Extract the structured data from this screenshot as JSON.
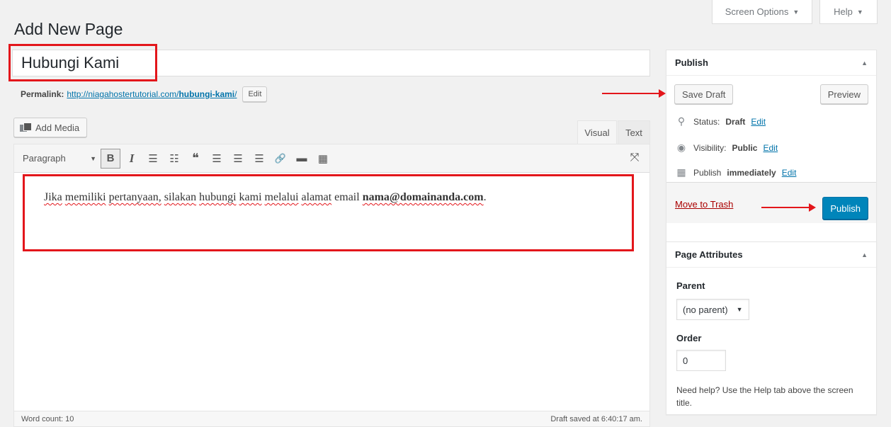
{
  "screen_meta": {
    "screen_options": "Screen Options",
    "help": "Help",
    "caret": "▼"
  },
  "page_title": "Add New Page",
  "post_title": {
    "value": "Hubungi Kami"
  },
  "permalink": {
    "label": "Permalink:",
    "url_base": "http://niagahostertutorial.com/",
    "slug": "hubungi-kami",
    "trailing": "/",
    "edit_label": "Edit"
  },
  "media": {
    "add_media_label": "Add Media"
  },
  "editor_tabs": {
    "visual": "Visual",
    "text": "Text"
  },
  "toolbar": {
    "format": "Paragraph",
    "format_caret": "▼",
    "bold": "B",
    "italic": "I",
    "bullet_list": "☰",
    "numbered_list": "☷",
    "blockquote": "❝",
    "align_left": "☰",
    "align_center": "☰",
    "align_right": "☰",
    "link": "🔗",
    "read_more": "▬",
    "toolbar_toggle": "▦",
    "fullscreen": "⤧"
  },
  "content": {
    "words": [
      "Jika",
      "memiliki",
      "pertanyaan,",
      "silakan",
      "hubungi",
      "kami",
      "melalui",
      "alamat"
    ],
    "plain": "email",
    "email": "nama@domainanda.com",
    "end": "."
  },
  "status_bar": {
    "word_count": "Word count: 10",
    "draft_saved": "Draft saved at 6:40:17 am."
  },
  "publish_box": {
    "title": "Publish",
    "save_draft": "Save Draft",
    "preview": "Preview",
    "status_label": "Status:",
    "status_value": "Draft",
    "visibility_label": "Visibility:",
    "visibility_value": "Public",
    "publish_label": "Publish",
    "publish_value": "immediately",
    "edit": "Edit",
    "move_to_trash": "Move to Trash",
    "publish_button": "Publish",
    "toggle": "▲"
  },
  "page_attributes": {
    "title": "Page Attributes",
    "parent_label": "Parent",
    "parent_value": "(no parent)",
    "order_label": "Order",
    "order_value": "0",
    "help_text": "Need help? Use the Help tab above the screen title.",
    "toggle": "▲",
    "caret": "▼"
  },
  "colors": {
    "annotation_red": "#e3161b",
    "primary_blue": "#0085ba",
    "link_blue": "#0073aa",
    "trash_red": "#a00000"
  }
}
